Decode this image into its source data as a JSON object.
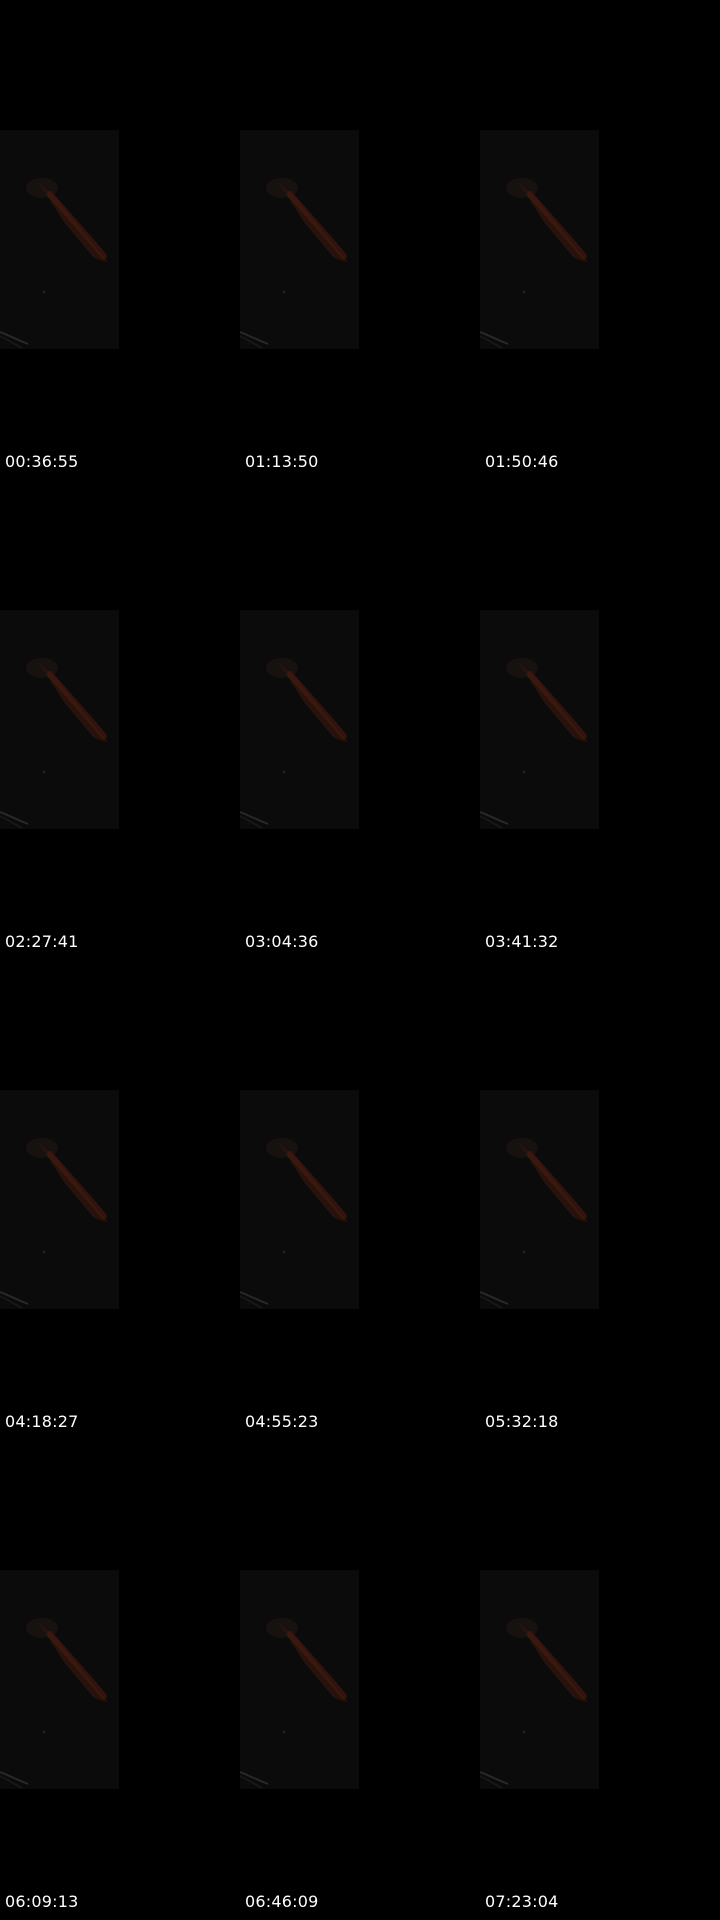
{
  "colors": {
    "background": "#000000",
    "thumbnail_bg": "#0b0b0b",
    "timestamp_text": "#ffffff",
    "subject_glow": "#3a170f"
  },
  "frames": [
    {
      "timestamp": "00:36:55"
    },
    {
      "timestamp": "01:13:50"
    },
    {
      "timestamp": "01:50:46"
    },
    {
      "timestamp": "02:27:41"
    },
    {
      "timestamp": "03:04:36"
    },
    {
      "timestamp": "03:41:32"
    },
    {
      "timestamp": "04:18:27"
    },
    {
      "timestamp": "04:55:23"
    },
    {
      "timestamp": "05:32:18"
    },
    {
      "timestamp": "06:09:13"
    },
    {
      "timestamp": "06:46:09"
    },
    {
      "timestamp": "07:23:04"
    }
  ]
}
